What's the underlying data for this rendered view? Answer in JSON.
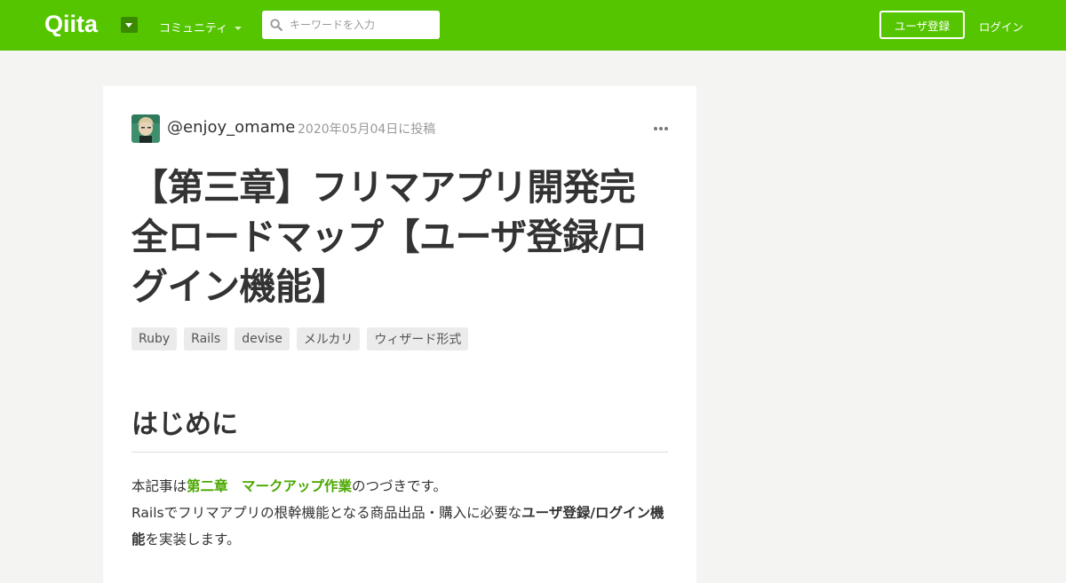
{
  "header": {
    "logo_text": "Qiita",
    "community_label": "コミュニティ",
    "search_placeholder": "キーワードを入力",
    "signup_label": "ユーザ登録",
    "login_label": "ログイン",
    "brand_color": "#55c500"
  },
  "article": {
    "author": "@enjoy_omame",
    "date": "2020年05月04日に投稿",
    "title": "【第三章】フリマアプリ開発完全ロードマップ【ユーザ登録/ログイン機能】",
    "tags": [
      {
        "label": "Ruby"
      },
      {
        "label": "Rails"
      },
      {
        "label": "devise"
      },
      {
        "label": "メルカリ"
      },
      {
        "label": "ウィザード形式"
      }
    ],
    "section_heading": "はじめに",
    "intro": {
      "prefix": "本記事は",
      "link": "第二章　マークアップ作業",
      "suffix": "のつづきです。"
    },
    "line2": {
      "prefix": "Railsでフリマアプリの根幹機能となる商品出品・購入に必要な",
      "bold": "ユーザ登録/ログイン機能",
      "suffix": "を実装します。"
    }
  }
}
